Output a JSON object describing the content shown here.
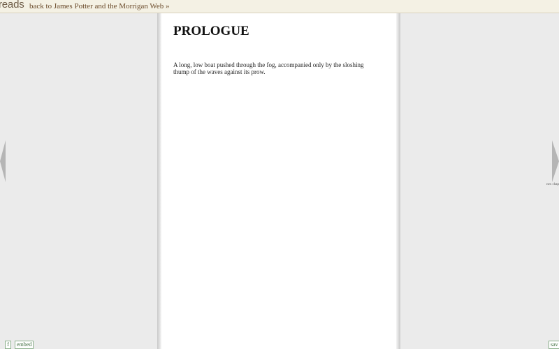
{
  "topbar": {
    "logo_text": "reads",
    "back_link": "back to James Potter and the Morrigan Web »"
  },
  "page": {
    "chapter_title": "PROLOGUE",
    "text": "A long, low boat pushed through the fog, accompanied only by the sloshing thump of the waves against its prow."
  },
  "nav": {
    "prev_caption": "",
    "next_caption": "nex chap",
    "prev_icon": "triangle-left-icon",
    "next_icon": "triangle-right-icon"
  },
  "footer": {
    "f_label": "f",
    "embed_label": "embed",
    "save_label": "sav"
  },
  "colors": {
    "background": "#ebebeb",
    "page": "#ffffff",
    "arrow": "#b5b5b5",
    "button_border": "#8bb08b",
    "link": "#6a4a2a"
  }
}
